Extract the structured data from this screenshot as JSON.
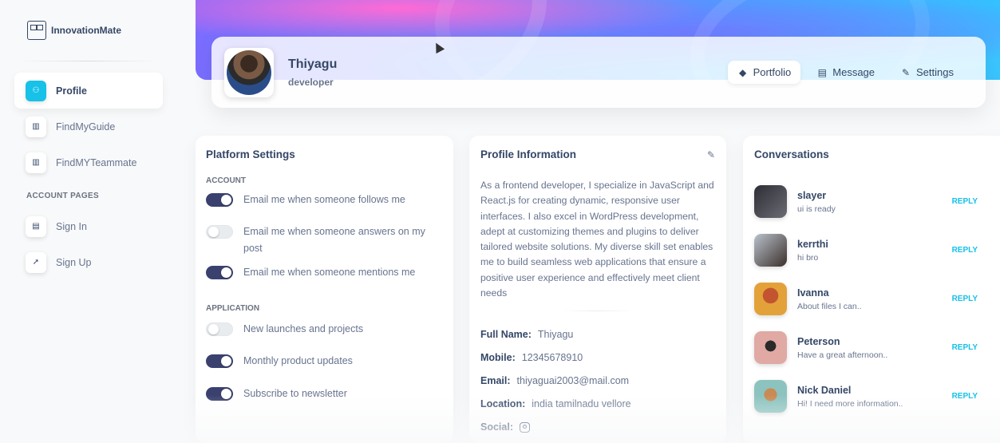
{
  "brand": {
    "name": "InnovationMate"
  },
  "sidebar": {
    "items": [
      {
        "label": "Profile",
        "icon": "profile-icon"
      },
      {
        "label": "FindMyGuide",
        "icon": "shop-icon"
      },
      {
        "label": "FindMYTeammate",
        "icon": "shop-icon"
      }
    ],
    "section_label": "ACCOUNT PAGES",
    "account_items": [
      {
        "label": "Sign In",
        "icon": "document-icon"
      },
      {
        "label": "Sign Up",
        "icon": "rocket-icon"
      }
    ]
  },
  "profile": {
    "name": "Thiyagu",
    "role": "developer",
    "tabs": [
      {
        "label": "Portfolio",
        "icon": "cube-icon"
      },
      {
        "label": "Message",
        "icon": "document-icon"
      },
      {
        "label": "Settings",
        "icon": "wrench-icon"
      }
    ]
  },
  "platform_settings": {
    "title": "Platform Settings",
    "account_label": "ACCOUNT",
    "account": [
      {
        "label": "Email me when someone follows me",
        "on": true
      },
      {
        "label": "Email me when someone answers on my post",
        "on": false
      },
      {
        "label": "Email me when someone mentions me",
        "on": true
      }
    ],
    "application_label": "APPLICATION",
    "application": [
      {
        "label": "New launches and projects",
        "on": false
      },
      {
        "label": "Monthly product updates",
        "on": true
      },
      {
        "label": "Subscribe to newsletter",
        "on": true
      }
    ]
  },
  "profile_info": {
    "title": "Profile Information",
    "description": "As a frontend developer, I specialize in JavaScript and React.js for creating dynamic, responsive user interfaces. I also excel in WordPress development, adept at customizing themes and plugins to deliver tailored website solutions. My diverse skill set enables me to build seamless web applications that ensure a positive user experience and effectively meet client needs",
    "fields": [
      {
        "label": "Full Name:",
        "value": "Thiyagu"
      },
      {
        "label": "Mobile:",
        "value": "12345678910"
      },
      {
        "label": "Email:",
        "value": "thiyaguai2003@mail.com"
      },
      {
        "label": "Location:",
        "value": "india tamilnadu vellore"
      }
    ],
    "social_label": "Social:"
  },
  "conversations": {
    "title": "Conversations",
    "reply_label": "REPLY",
    "items": [
      {
        "name": "slayer",
        "message": "ui is ready",
        "color": "#2d2d35"
      },
      {
        "name": "kerrthi",
        "message": "hi bro",
        "color": "#6f7a86"
      },
      {
        "name": "Ivanna",
        "message": "About files I can..",
        "color": "#d98a2b"
      },
      {
        "name": "Peterson",
        "message": "Have a great afternoon..",
        "color": "#c98a86"
      },
      {
        "name": "Nick Daniel",
        "message": "Hi! I need more information..",
        "color": "#7fb3b0"
      }
    ]
  },
  "colors": {
    "accent": "#17c1e8",
    "toggle_on": "#3a416f",
    "text_dark": "#344767",
    "text_muted": "#67748e"
  }
}
